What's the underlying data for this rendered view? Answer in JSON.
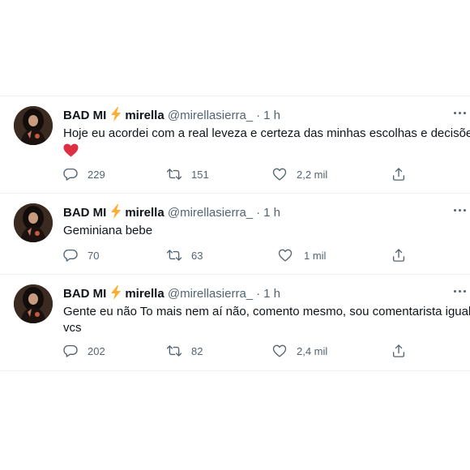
{
  "tweets": [
    {
      "display_name": "BAD MI",
      "display_name_2": "mirella",
      "handle": "@mirellasierra_",
      "time": "1 h",
      "text_lines": [
        "Hoje eu acordei com a real leveza e certeza das minhas escolhas e decisões"
      ],
      "has_heart_emoji": true,
      "replies": "229",
      "retweets": "151",
      "likes": "2,2 mil"
    },
    {
      "display_name": "BAD MI",
      "display_name_2": "mirella",
      "handle": "@mirellasierra_",
      "time": "1 h",
      "text_lines": [
        "Geminiana bebe"
      ],
      "has_heart_emoji": false,
      "replies": "70",
      "retweets": "63",
      "likes": "1 mil"
    },
    {
      "display_name": "BAD MI",
      "display_name_2": "mirella",
      "handle": "@mirellasierra_",
      "time": "1 h",
      "text_lines": [
        "Gente eu não To mais nem aí não, comento mesmo, sou comentarista igual",
        "vcs"
      ],
      "has_heart_emoji": false,
      "replies": "202",
      "retweets": "82",
      "likes": "2,4 mil"
    }
  ],
  "colors": {
    "text": "#0f1419",
    "secondary": "#536471",
    "divider": "#eff3f4",
    "bolt": "#ffac33",
    "heart": "#dd2e44"
  },
  "icons": [
    "more-icon",
    "reply-icon",
    "retweet-icon",
    "like-icon",
    "share-icon",
    "lightning-emoji",
    "red-heart-emoji"
  ]
}
